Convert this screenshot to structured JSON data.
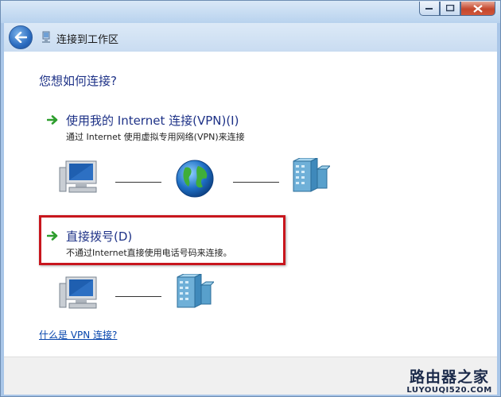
{
  "window": {
    "title": "连接到工作区"
  },
  "main": {
    "heading": "您想如何连接?",
    "options": [
      {
        "title": "使用我的 Internet 连接(VPN)(I)",
        "description": "通过 Internet 使用虚拟专用网络(VPN)来连接"
      },
      {
        "title": "直接拨号(D)",
        "description": "不通过Internet直接使用电话号码来连接。",
        "highlighted": true
      }
    ],
    "help_link": "什么是 VPN 连接?"
  },
  "watermark": {
    "line1": "路由器之家",
    "line2": "LUYOUQI520.COM"
  },
  "colors": {
    "accent_text": "#1e3287",
    "highlight_border": "#c8161d",
    "arrow_green": "#2e9e2e",
    "link": "#0645ad"
  },
  "icons": [
    "back-arrow-icon",
    "network-icon",
    "computer-icon",
    "globe-icon",
    "server-icon",
    "green-arrow-icon"
  ]
}
